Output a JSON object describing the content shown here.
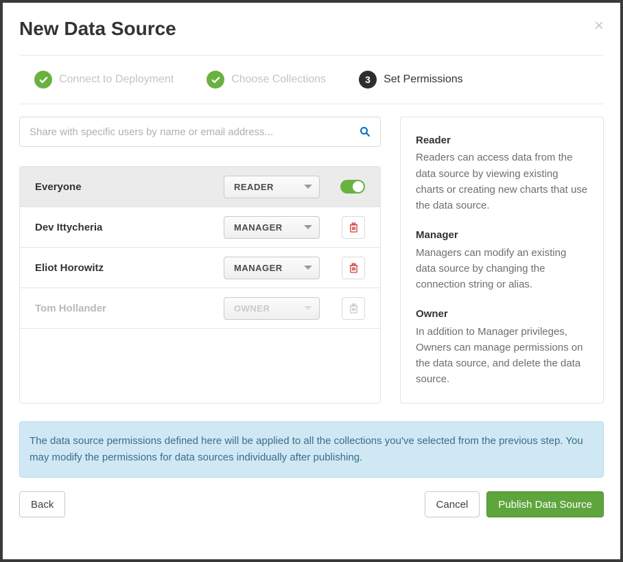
{
  "modal": {
    "title": "New Data Source",
    "close_label": "×"
  },
  "steps": {
    "s1": {
      "label": "Connect to Deployment"
    },
    "s2": {
      "label": "Choose Collections"
    },
    "s3": {
      "number": "3",
      "label": "Set Permissions"
    }
  },
  "search": {
    "placeholder": "Share with specific users by name or email address..."
  },
  "permissions": {
    "rows": [
      {
        "name": "Everyone",
        "role": "READER",
        "type": "toggle",
        "highlight": true,
        "disabled": false
      },
      {
        "name": "Dev Ittycheria",
        "role": "MANAGER",
        "type": "delete",
        "highlight": false,
        "disabled": false
      },
      {
        "name": "Eliot Horowitz",
        "role": "MANAGER",
        "type": "delete",
        "highlight": false,
        "disabled": false
      },
      {
        "name": "Tom Hollander",
        "role": "OWNER",
        "type": "delete",
        "highlight": false,
        "disabled": true
      }
    ]
  },
  "help": {
    "reader": {
      "title": "Reader",
      "body": "Readers can access data from the data source by viewing existing charts or creating new charts that use the data source."
    },
    "manager": {
      "title": "Manager",
      "body": "Managers can modify an existing data source by changing the connection string or alias."
    },
    "owner": {
      "title": "Owner",
      "body": "In addition to Manager privileges, Owners can manage permissions on the data source, and delete the data source."
    }
  },
  "info": {
    "text": "The data source permissions defined here will be applied to all the collections you've selected from the previous step. You may modify the permissions for data sources individually after publishing."
  },
  "footer": {
    "back": "Back",
    "cancel": "Cancel",
    "publish": "Publish Data Source"
  }
}
